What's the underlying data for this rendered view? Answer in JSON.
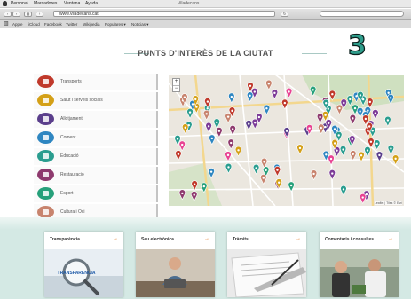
{
  "browser": {
    "menu": [
      "Personal",
      "Marcadores",
      "Ventana",
      "Ayuda"
    ],
    "window_title": "Viladecans",
    "url": "www.viladecans.cat",
    "bookmarks": [
      "Apple",
      "iCloud",
      "Facebook",
      "Twitter",
      "Wikipedia",
      "Populares ▾",
      "Noticias ▾"
    ]
  },
  "section": {
    "title": "PUNTS D'INTERÈS DE LA CIUTAT",
    "badge": "3"
  },
  "categories": [
    {
      "label": "Transports",
      "color": "#c0392b",
      "icon": "bus-icon"
    },
    {
      "label": "Salut i serveis socials",
      "color": "#d4a017",
      "icon": "health-icon"
    },
    {
      "label": "Allotjament",
      "color": "#5b3f8c",
      "icon": "bed-icon"
    },
    {
      "label": "Comerç",
      "color": "#2e86c1",
      "icon": "shop-icon"
    },
    {
      "label": "Educació",
      "color": "#2a9d8f",
      "icon": "school-icon"
    },
    {
      "label": "Restauració",
      "color": "#8e3a6e",
      "icon": "food-icon"
    },
    {
      "label": "Esport",
      "color": "#26a07a",
      "icon": "sport-icon"
    },
    {
      "label": "Cultura i Oci",
      "color": "#c8846e",
      "icon": "culture-icon"
    }
  ],
  "map": {
    "zoom_in": "+",
    "zoom_out": "−",
    "attribution": "Leaflet | Tiles © Esri"
  },
  "cards": [
    {
      "title": "Transparència",
      "arrow": "→",
      "image_text": "TRANSPARENCIA"
    },
    {
      "title": "Seu electrònica",
      "arrow": "→"
    },
    {
      "title": "Tràmits",
      "arrow": "→"
    },
    {
      "title": "Comentaris i consultes",
      "arrow": "→"
    }
  ],
  "colors": {
    "accent_teal": "#2f9e8c",
    "band": "#d4e9e4",
    "arrow_orange": "#e07b2a"
  }
}
